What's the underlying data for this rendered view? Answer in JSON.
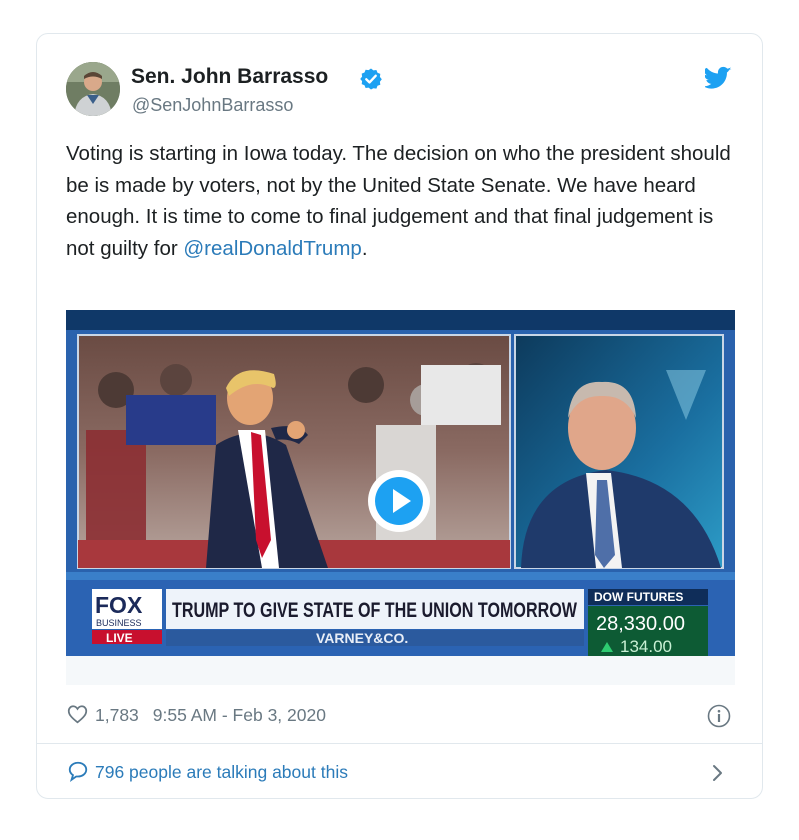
{
  "tweet": {
    "author_name": "Sen. John Barrasso",
    "author_handle": "@SenJohnBarrasso",
    "verified": true,
    "text": "Voting is starting in Iowa today. The decision on who the president should be is made by voters, not by the United State Senate. We have heard enough. It is time to come to final judgement and that final judgement is not guilty for ",
    "mention": "@realDonaldTrump",
    "text_end": ".",
    "likes": "1,783",
    "timestamp": "9:55 AM - Feb 3, 2020",
    "talking": "796 people are talking about this"
  },
  "video": {
    "network_logo": "FOX",
    "network_sub": "BUSINESS",
    "live_label": "LIVE",
    "headline": "TRUMP TO GIVE STATE OF THE UNION TOMORROW",
    "show_name": "VARNEY&CO.",
    "market_label": "DOW FUTURES",
    "market_value": "28,330.00",
    "market_change": "134.00"
  },
  "colors": {
    "link": "#2b7bb9",
    "verified": "#1da1f2",
    "muted": "#697882",
    "fox_red": "#c8102e"
  },
  "icons": [
    "twitter-bird-icon",
    "verified-badge-icon",
    "play-icon",
    "heart-icon",
    "info-icon",
    "speech-bubble-icon",
    "chevron-right-icon"
  ]
}
